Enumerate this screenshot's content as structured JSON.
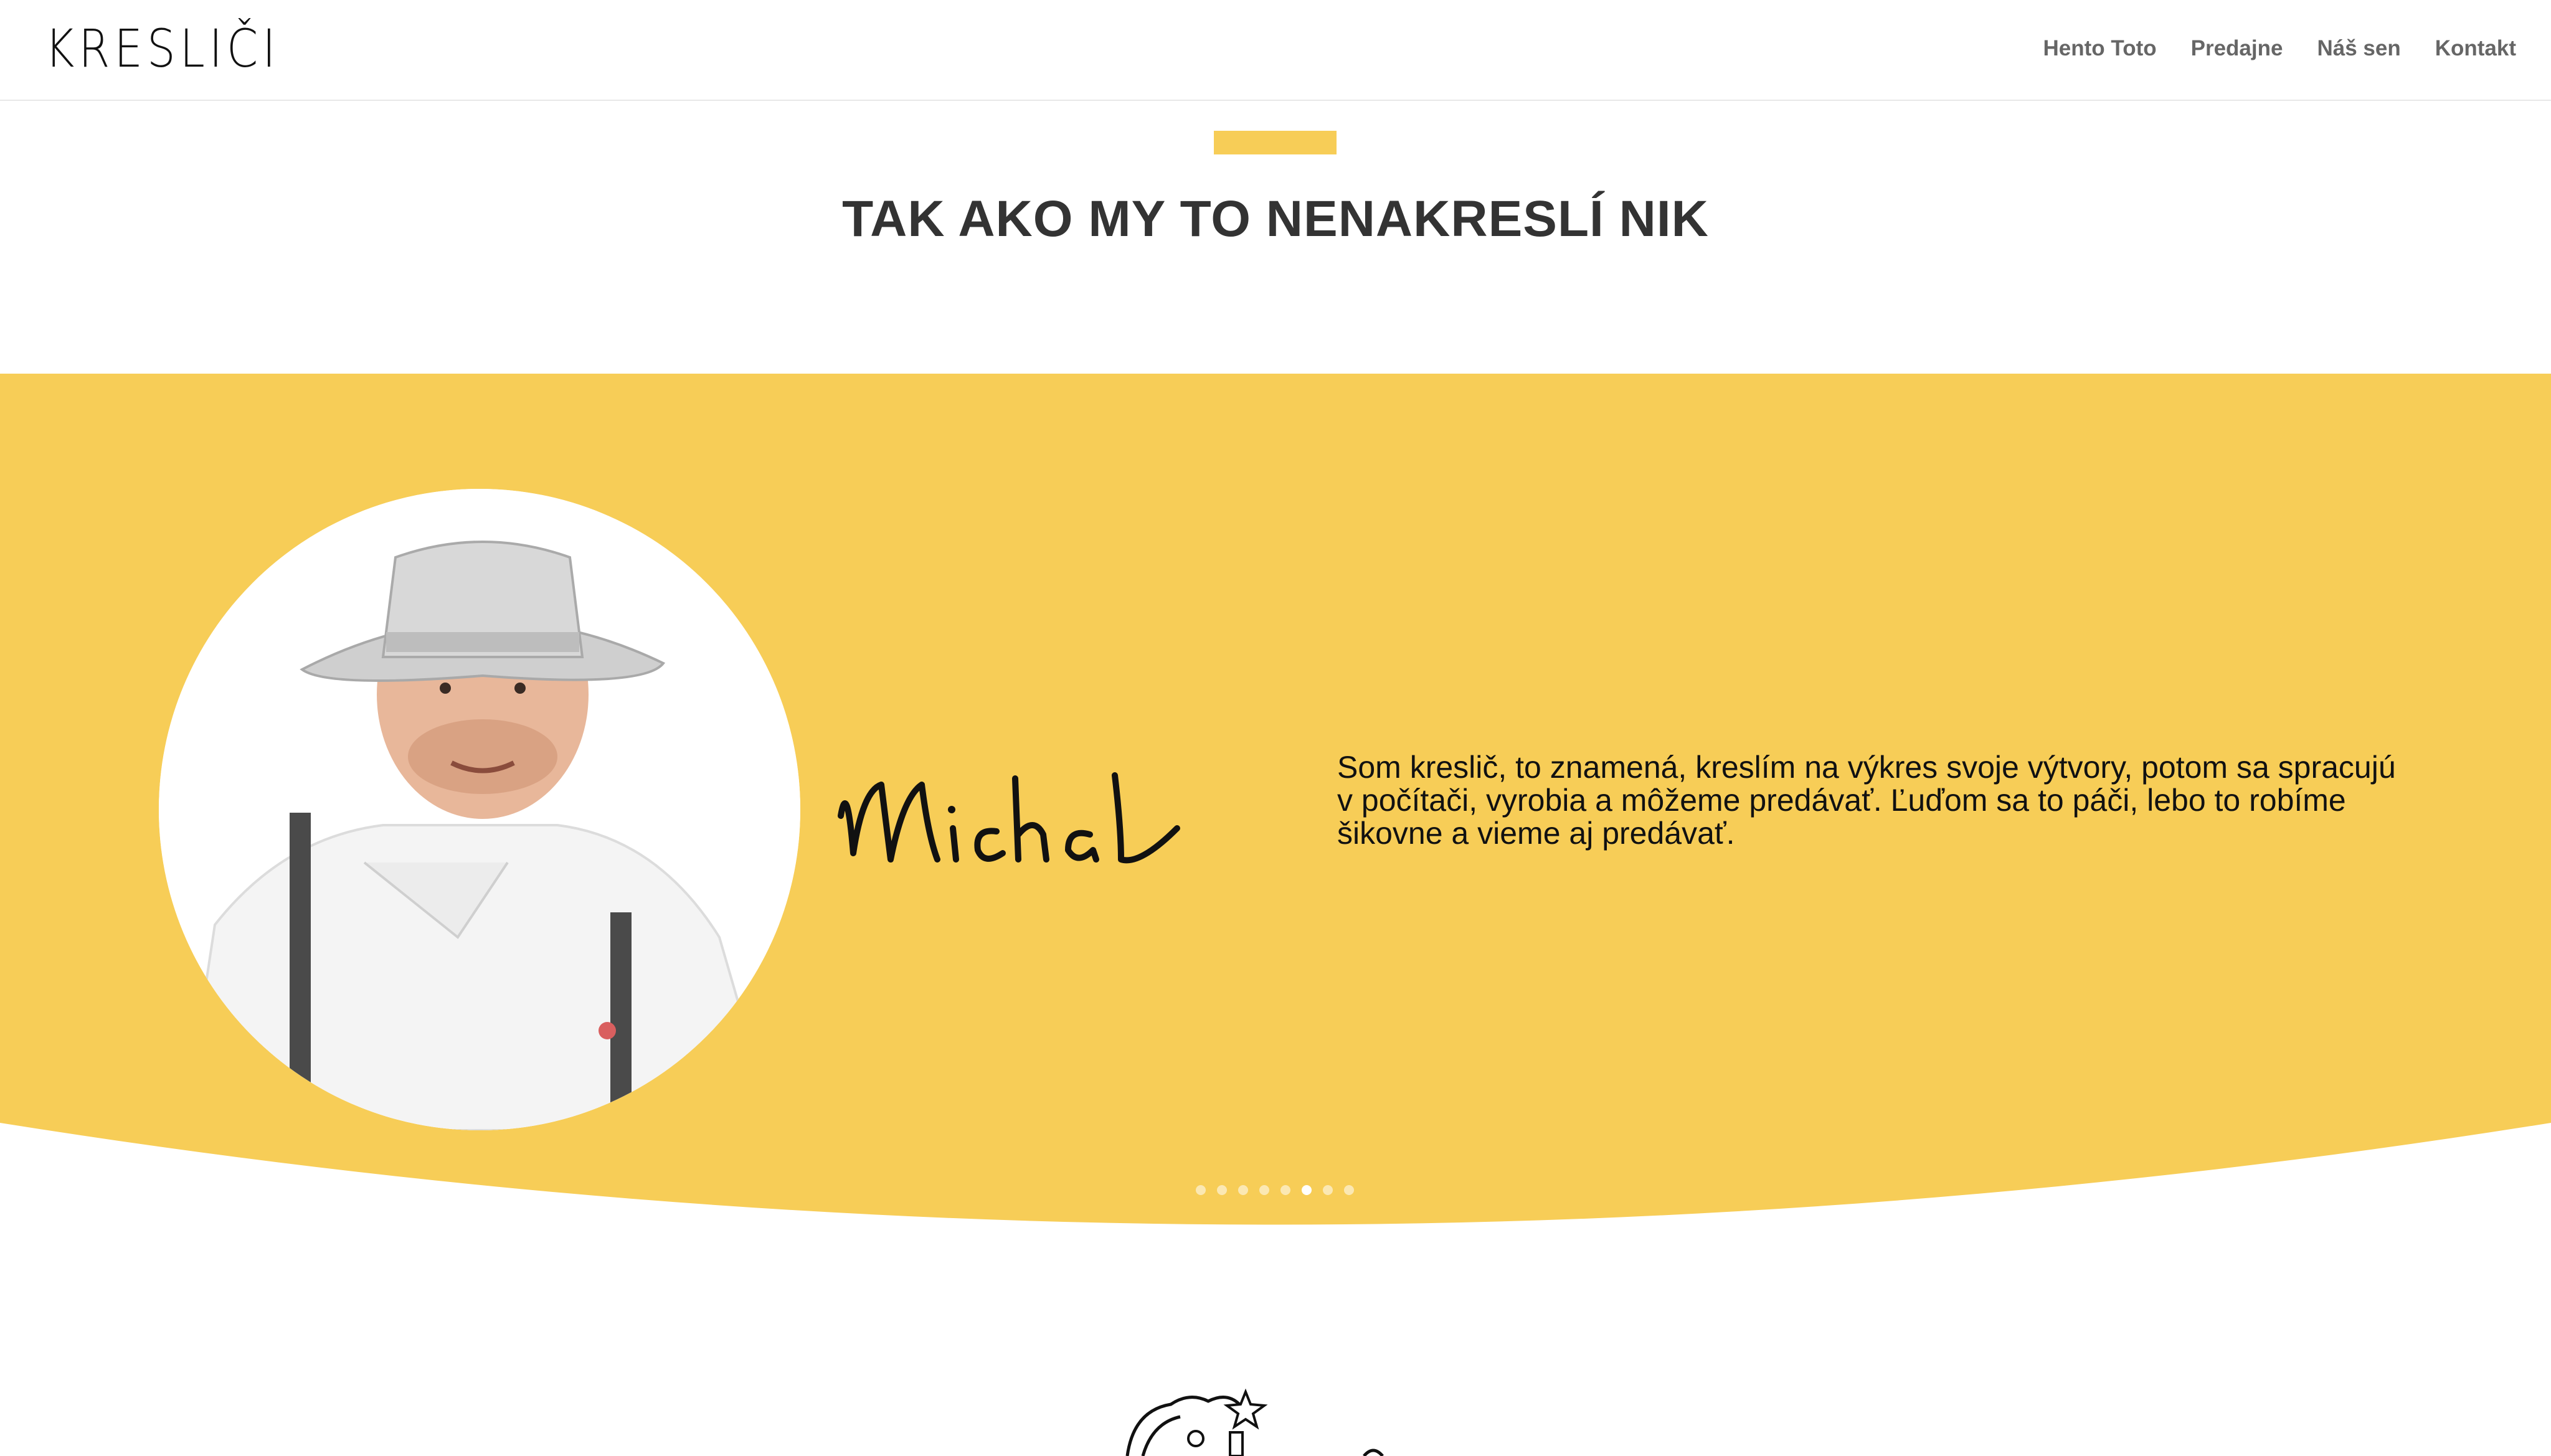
{
  "brand": {
    "logo_text": "KRESLIČI"
  },
  "nav": {
    "items": [
      {
        "label": "Hento Toto"
      },
      {
        "label": "Predajne"
      },
      {
        "label": "Náš sen"
      },
      {
        "label": "Kontakt"
      }
    ]
  },
  "hero": {
    "headline": "TAK AKO MY TO NENAKRESLÍ NIK"
  },
  "slider": {
    "signature": "Michal",
    "quote": "Som kreslič, to znamená, kreslím na výkres svoje výtvory, potom sa spracujú v počítači, vyrobia a môžeme predávať. Ľuďom sa to páči, lebo to robíme šikovne a vieme aj predávať.",
    "pagination": {
      "total": 8,
      "active": 6
    }
  },
  "colors": {
    "accent": "#f7cd57",
    "heading": "#333333",
    "nav_text": "#666666"
  }
}
